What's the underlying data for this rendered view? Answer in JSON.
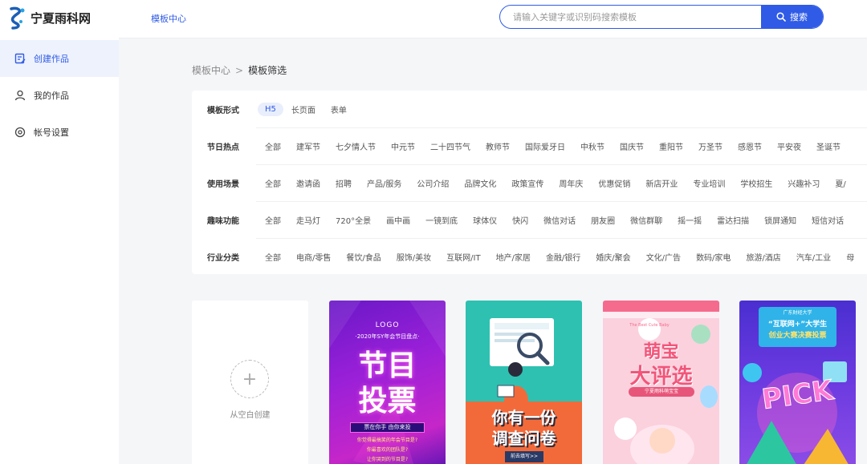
{
  "brand": {
    "name": "宁夏雨科网"
  },
  "sidebar": {
    "items": [
      {
        "label": "创建作品",
        "icon": "edit-doc-icon",
        "active": true
      },
      {
        "label": "我的作品",
        "icon": "user-icon",
        "active": false
      },
      {
        "label": "帐号设置",
        "icon": "settings-icon",
        "active": false
      }
    ]
  },
  "header": {
    "link": "模板中心",
    "search": {
      "placeholder": "请输入关键字或识别码搜索模板",
      "button": "搜索"
    }
  },
  "breadcrumb": {
    "parent": "模板中心",
    "separator": ">",
    "current": "模板筛选"
  },
  "filters": [
    {
      "label": "模板形式",
      "options": [
        "H5",
        "长页面",
        "表单"
      ],
      "selected": 0
    },
    {
      "label": "节日热点",
      "options": [
        "全部",
        "建军节",
        "七夕情人节",
        "中元节",
        "二十四节气",
        "教师节",
        "国际爱牙日",
        "中秋节",
        "国庆节",
        "重阳节",
        "万圣节",
        "感恩节",
        "平安夜",
        "圣诞节"
      ],
      "selected": -1
    },
    {
      "label": "使用场景",
      "options": [
        "全部",
        "邀请函",
        "招聘",
        "产品/服务",
        "公司介绍",
        "品牌文化",
        "政策宣传",
        "周年庆",
        "优惠促销",
        "新店开业",
        "专业培训",
        "学校招生",
        "兴趣补习",
        "夏/"
      ],
      "selected": -1
    },
    {
      "label": "趣味功能",
      "options": [
        "全部",
        "走马灯",
        "720°全景",
        "画中画",
        "一镜到底",
        "球体仪",
        "快闪",
        "微信对话",
        "朋友圈",
        "微信群聊",
        "摇一摇",
        "雷达扫描",
        "锁屏通知",
        "短信对话"
      ],
      "selected": -1
    },
    {
      "label": "行业分类",
      "options": [
        "全部",
        "电商/零售",
        "餐饮/食品",
        "服饰/美妆",
        "互联网/IT",
        "地产/家居",
        "金融/银行",
        "婚庆/聚会",
        "文化/广告",
        "数码/家电",
        "旅游/酒店",
        "汽车/工业",
        "母"
      ],
      "selected": -1
    }
  ],
  "blank_card": {
    "label": "从空白创建"
  },
  "cards": [
    {
      "logo": "LOGO",
      "subtitle": "·2020年SY年会节目盘点·",
      "title_1": "节目",
      "title_2": "投票",
      "cta": "票在你手 由你来投",
      "q1": "你觉得最搞笑的年会节目是?",
      "q2": "你最喜欢的团队是?",
      "q3": "让你哭到的节目是?"
    },
    {
      "title_1": "你有一份",
      "title_2": "调查问卷",
      "cta": "前去填写>>"
    },
    {
      "tag": "The Best Cute Baby",
      "title_1": "萌宝",
      "title_2": "大评选",
      "badge": "宁夏雨科萌宝宝"
    },
    {
      "school": "广东财经大学",
      "title_1": "“互联网+”大学生",
      "title_2": "创业大赛决赛投票",
      "pick": "PICK"
    }
  ]
}
